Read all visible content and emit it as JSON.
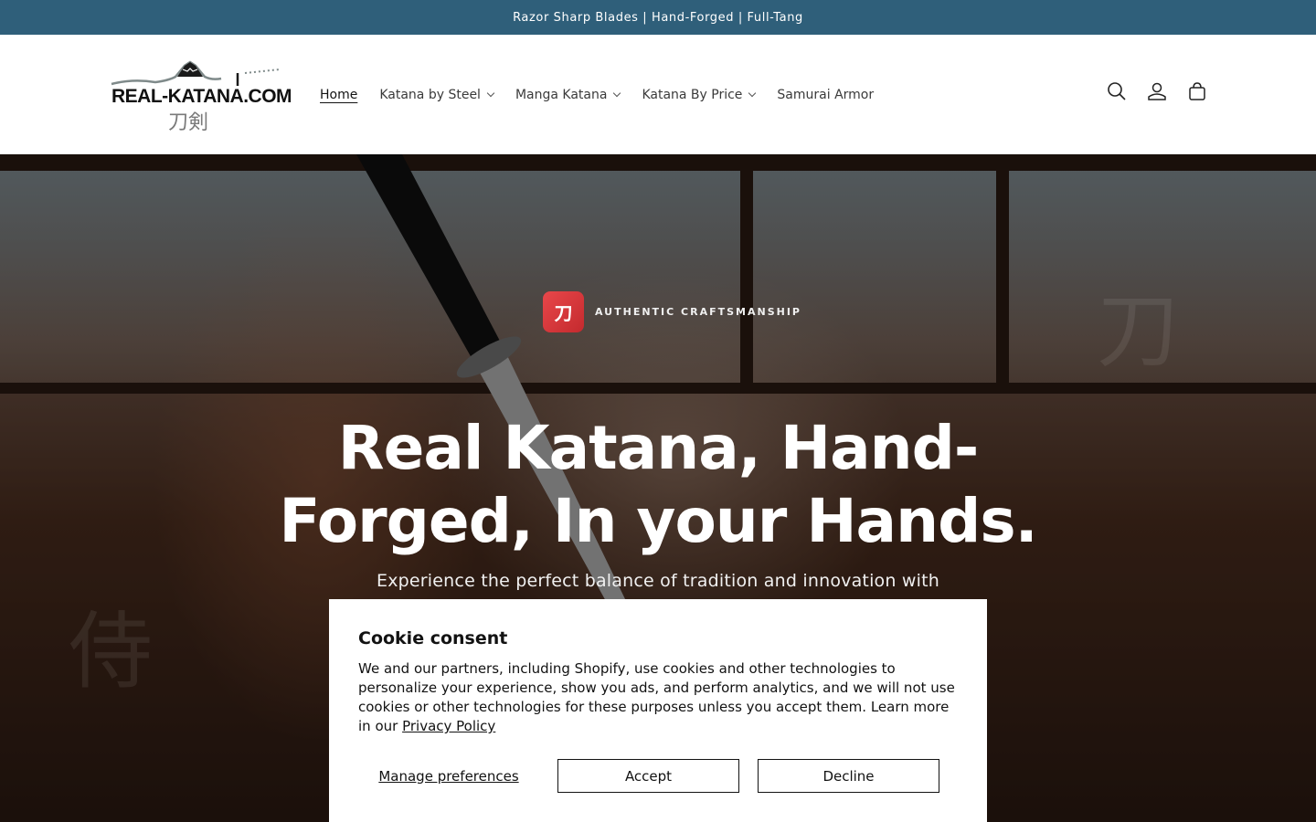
{
  "announcement": {
    "text": "Razor Sharp Blades | Hand-Forged | Full-Tang"
  },
  "header": {
    "logo": {
      "text": "REAL-KATANA.COM",
      "kanji": "刀剣"
    },
    "nav": [
      {
        "label": "Home",
        "active": true,
        "dropdown": false
      },
      {
        "label": "Katana by Steel",
        "active": false,
        "dropdown": true
      },
      {
        "label": "Manga Katana",
        "active": false,
        "dropdown": true
      },
      {
        "label": "Katana By Price",
        "active": false,
        "dropdown": true
      },
      {
        "label": "Samurai Armor",
        "active": false,
        "dropdown": false
      }
    ],
    "icons": [
      "search-icon",
      "account-icon",
      "cart-icon"
    ]
  },
  "hero": {
    "badge_glyph": "刀",
    "badge_text": "AUTHENTIC CRAFTSMANSHIP",
    "title": "Real Katana, Hand-Forged, In your Hands.",
    "subtitle": "Experience the perfect balance of tradition and innovation with"
  },
  "cookie": {
    "title": "Cookie consent",
    "body": "We and our partners, including Shopify, use cookies and other technologies to personalize your experience, show you ads, and perform analytics, and we will not use cookies or other technologies for these purposes unless you accept them. Learn more in our",
    "link": "Privacy Policy",
    "manage_label": "Manage preferences",
    "accept_label": "Accept",
    "decline_label": "Decline"
  },
  "colors": {
    "announcement_bg": "#2f5f7a",
    "badge_red": "#d9363a",
    "text_dark": "#121212"
  }
}
